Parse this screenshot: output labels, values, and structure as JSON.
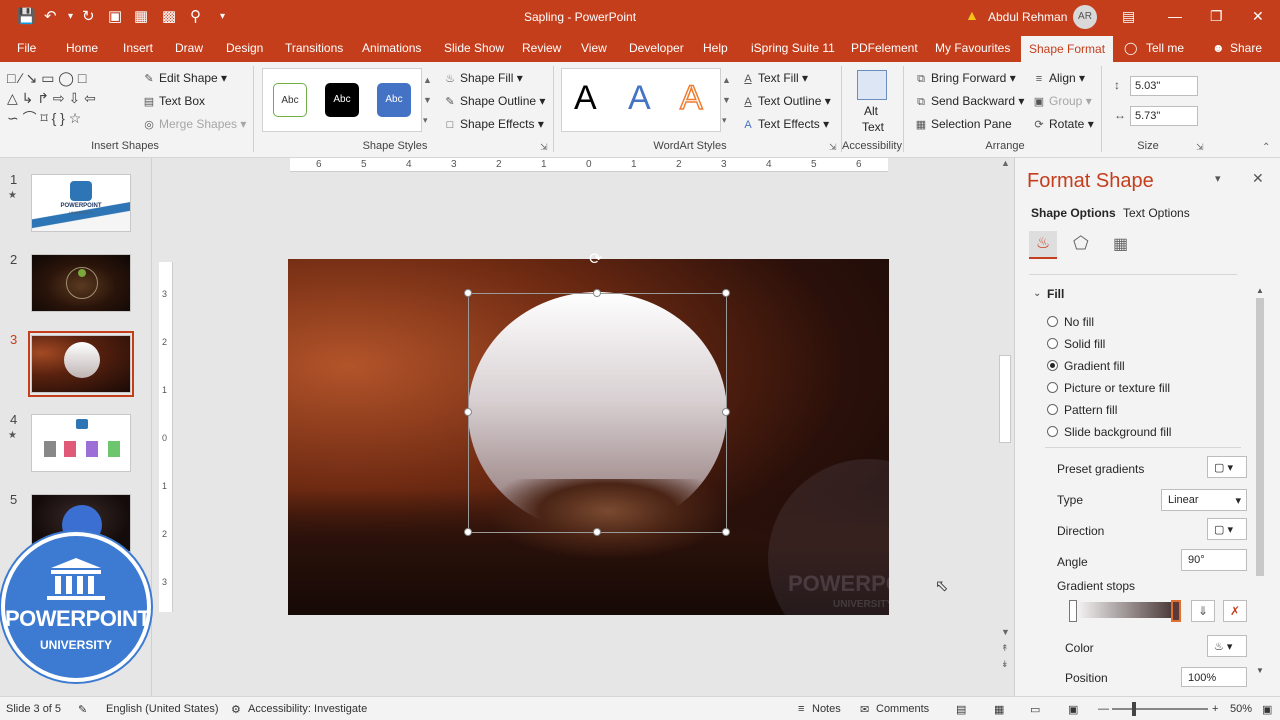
{
  "window": {
    "doc_title": "Sapling  -  PowerPoint",
    "user_name": "Abdul Rehman",
    "user_initials": "AR"
  },
  "tabs": [
    "File",
    "Home",
    "Insert",
    "Draw",
    "Design",
    "Transitions",
    "Animations",
    "Slide Show",
    "Review",
    "View",
    "Developer",
    "Help",
    "iSpring Suite 11",
    "PDFelement",
    "My Favourites",
    "Shape Format",
    "Tell me",
    "Share"
  ],
  "ribbon": {
    "insert_shapes": {
      "edit_shape": "Edit Shape",
      "text_box": "Text Box",
      "merge_shapes": "Merge Shapes",
      "label": "Insert Shapes"
    },
    "shape_styles": {
      "samples": [
        "Abc",
        "Abc",
        "Abc"
      ],
      "shape_fill": "Shape Fill",
      "shape_outline": "Shape Outline",
      "shape_effects": "Shape Effects",
      "label": "Shape Styles"
    },
    "wordart": {
      "samples": [
        "A",
        "A",
        "A"
      ],
      "text_fill": "Text Fill",
      "text_outline": "Text Outline",
      "text_effects": "Text Effects",
      "label": "WordArt Styles"
    },
    "accessibility": {
      "alt_text_1": "Alt",
      "alt_text_2": "Text",
      "label": "Accessibility"
    },
    "arrange": {
      "bring_forward": "Bring Forward",
      "send_backward": "Send Backward",
      "selection_pane": "Selection Pane",
      "align": "Align",
      "group": "Group",
      "rotate": "Rotate",
      "label": "Arrange"
    },
    "size": {
      "height": "5.03\"",
      "width": "5.73\"",
      "label": "Size"
    }
  },
  "ruler": {
    "top_ticks": [
      "6",
      "5",
      "4",
      "3",
      "2",
      "1",
      "0",
      "1",
      "2",
      "3",
      "4",
      "5",
      "6"
    ],
    "left_ticks": [
      "3",
      "2",
      "1",
      "0",
      "1",
      "2",
      "3"
    ]
  },
  "slides": [
    {
      "num": "1",
      "star": true
    },
    {
      "num": "2",
      "star": false
    },
    {
      "num": "3",
      "star": false
    },
    {
      "num": "4",
      "star": true
    },
    {
      "num": "5",
      "star": false
    }
  ],
  "thumb_text": {
    "t1": "POWERPOINT",
    "t1b": "UNIVERSITY"
  },
  "watermark": {
    "line1": "POWERPOINT",
    "line2": "UNIVERSITY"
  },
  "logo": {
    "line1": "POWERPOINT",
    "line2": "UNIVERSITY"
  },
  "format_pane": {
    "title": "Format Shape",
    "tab_shape": "Shape Options",
    "tab_text": "Text Options",
    "section": "Fill",
    "fill_options": [
      "No fill",
      "Solid fill",
      "Gradient fill",
      "Picture or texture fill",
      "Pattern fill",
      "Slide background fill"
    ],
    "selected_fill": "Gradient fill",
    "preset_gradients": "Preset gradients",
    "type_label": "Type",
    "type_value": "Linear",
    "direction_label": "Direction",
    "angle_label": "Angle",
    "angle_value": "90°",
    "gradient_stops": "Gradient stops",
    "color_label": "Color",
    "position_label": "Position",
    "position_value": "100%"
  },
  "status": {
    "slide_info": "Slide 3 of 5",
    "language": "English (United States)",
    "accessibility": "Accessibility: Investigate",
    "notes": "Notes",
    "comments": "Comments",
    "zoom": "50%"
  },
  "colors": {
    "accent": "#c43e1c",
    "logo_blue": "#3d7ad1"
  }
}
